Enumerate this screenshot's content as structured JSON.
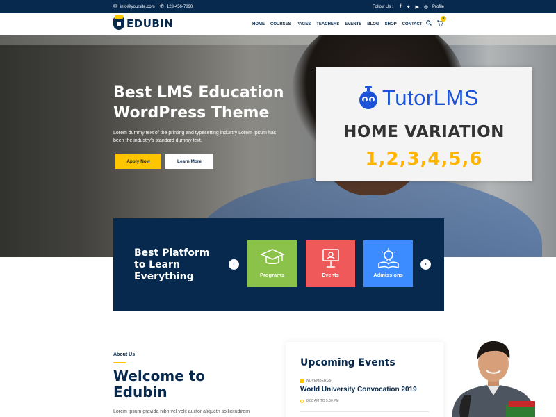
{
  "topbar": {
    "email": "info@yoursite.com",
    "phone": "123-456-7890",
    "follow_label": "Follow Us :",
    "social_icons": [
      "facebook-icon",
      "twitter-icon",
      "youtube-icon",
      "instagram-icon"
    ],
    "profile_label": "Profile"
  },
  "nav": {
    "logo_text": "EDUBIN",
    "items": [
      "HOME",
      "COURSES",
      "PAGES",
      "TEACHERS",
      "EVENTS",
      "BLOG",
      "SHOP",
      "CONTACT"
    ],
    "cart_count": "0"
  },
  "hero": {
    "title": "Best LMS Education WordPress Theme",
    "subtitle": "Lorem dummy text of the printing and typesetting industry Lorem Ipsum has been the industry's standard dummy text.",
    "apply_label": "Apply Now",
    "learn_label": "Learn More"
  },
  "tutor": {
    "brand": "TutorLMS",
    "variation": "HOME VARIATION",
    "numbers": "1,2,3,4,5,6"
  },
  "platform": {
    "title": "Best Platform to Learn Everything",
    "prev_label": "‹",
    "next_label": "›",
    "cards": [
      {
        "label": "Programs",
        "color": "#8bc34a",
        "icon": "graduation-cap-icon"
      },
      {
        "label": "Events",
        "color": "#ef5959",
        "icon": "presentation-icon"
      },
      {
        "label": "Admissions",
        "color": "#3d8cff",
        "icon": "lightbulb-book-icon"
      }
    ]
  },
  "about": {
    "label": "About Us",
    "title": "Welcome to Edubin",
    "text": "Lorem ipsum gravida nibh vel velit auctor aliquetn sollicitudirem"
  },
  "events": {
    "title": "Upcoming Events",
    "items": [
      {
        "date": "NOVEMBER 29",
        "name": "World University Convocation 2019",
        "time": "8:00 AM TO 5:00 PM"
      }
    ]
  },
  "colors": {
    "navy": "#07294d",
    "yellow": "#ffc600",
    "tutor_blue": "#1b52d8",
    "tutor_orange": "#ffb400"
  }
}
